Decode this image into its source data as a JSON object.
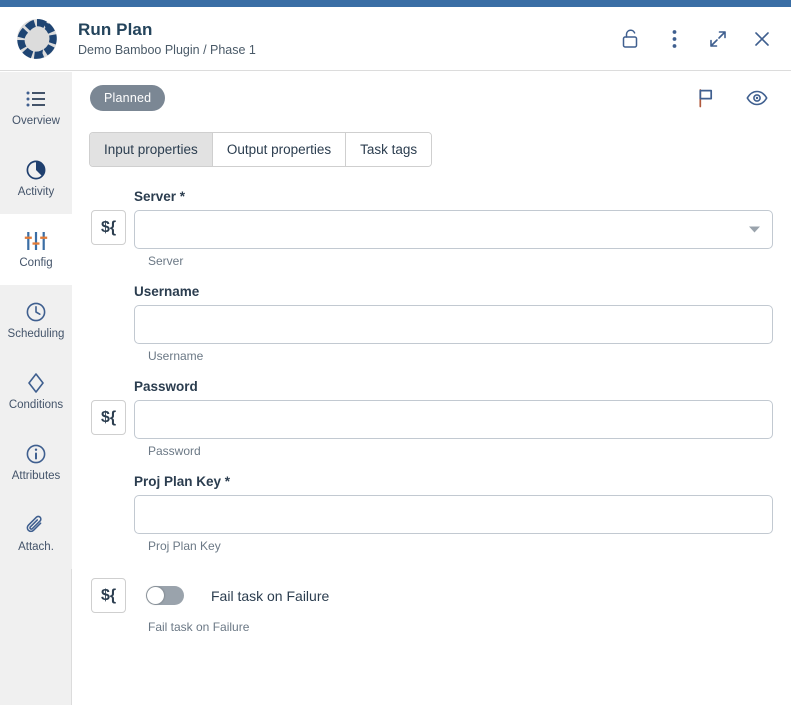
{
  "header": {
    "title": "Run Plan",
    "subtitle": "Demo Bamboo Plugin / Phase 1",
    "logo_icon": "circular-arrows-logo",
    "actions": [
      {
        "name": "unlock-button",
        "icon": "unlock-icon"
      },
      {
        "name": "more-options-button",
        "icon": "vertical-dots-icon"
      },
      {
        "name": "expand-button",
        "icon": "expand-diagonal-icon"
      },
      {
        "name": "close-button",
        "icon": "close-x-icon"
      }
    ]
  },
  "sidebar": {
    "items": [
      {
        "label": "Overview",
        "icon": "list-icon",
        "active": false
      },
      {
        "label": "Activity",
        "icon": "pie-clock-icon",
        "active": false
      },
      {
        "label": "Config",
        "icon": "sliders-icon",
        "active": true
      },
      {
        "label": "Scheduling",
        "icon": "clock-icon",
        "active": false
      },
      {
        "label": "Conditions",
        "icon": "diamond-icon",
        "active": false
      },
      {
        "label": "Attributes",
        "icon": "info-circle-icon",
        "active": false
      },
      {
        "label": "Attach.",
        "icon": "paperclip-icon",
        "active": false
      }
    ]
  },
  "content": {
    "status_badge": "Planned",
    "topbar_actions": [
      {
        "name": "flag-button",
        "icon": "flag-icon"
      },
      {
        "name": "watch-button",
        "icon": "eye-icon"
      }
    ],
    "tabs": [
      {
        "label": "Input properties",
        "active": true
      },
      {
        "label": "Output properties",
        "active": false
      },
      {
        "label": "Task tags",
        "active": false
      }
    ],
    "variable_button_label": "${",
    "fields": [
      {
        "label": "Server *",
        "value": "",
        "placeholder": "",
        "help": "Server",
        "has_variable_button": true,
        "has_dropdown": true
      },
      {
        "label": "Username",
        "value": "",
        "placeholder": "",
        "help": "Username",
        "has_variable_button": false,
        "has_dropdown": false
      },
      {
        "label": "Password",
        "value": "",
        "placeholder": "",
        "help": "Password",
        "has_variable_button": true,
        "has_dropdown": false
      },
      {
        "label": "Proj Plan Key *",
        "value": "",
        "placeholder": "",
        "help": "Proj Plan Key",
        "has_variable_button": false,
        "has_dropdown": false
      }
    ],
    "toggle": {
      "label": "Fail task on Failure",
      "help": "Fail task on Failure",
      "enabled": false,
      "has_variable_button": true
    }
  },
  "colors": {
    "accent_bar": "#3a6ea5",
    "icon_blue": "#34558b",
    "icon_orange": "#e07b39",
    "badge_gray": "#7b8794",
    "sidebar_bg": "#f0f0f0",
    "title_text": "#24445c"
  }
}
